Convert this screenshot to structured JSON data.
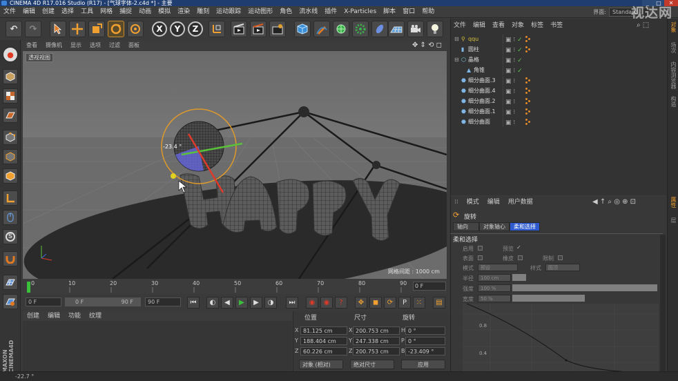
{
  "window": {
    "title": "CINEMA 4D R17.016 Studio (R17) - [气球字体-2.c4d *] - 主要",
    "controls": [
      "_",
      "□",
      "✕"
    ],
    "watermark": "视达网",
    "layout_label": "界面:",
    "layout_value": "Standard"
  },
  "menubar": {
    "items": [
      "文件",
      "编辑",
      "创建",
      "选择",
      "工具",
      "网格",
      "捕捉",
      "动画",
      "模拟",
      "渲染",
      "雕刻",
      "运动跟踪",
      "运动图形",
      "角色",
      "流水线",
      "插件",
      "X-Particles",
      "脚本",
      "窗口",
      "帮助"
    ]
  },
  "toolbar": {
    "undo_icon": "↶",
    "redo_icon": "↷",
    "axis_x": "X",
    "axis_y": "Y",
    "axis_z": "Z"
  },
  "viewport": {
    "menu": [
      "查看",
      "摄像机",
      "显示",
      "选项",
      "过滤",
      "面板"
    ],
    "camera_label": "透视视图",
    "grid_distance": "网格间距 : 1000 cm",
    "rotation_readout": "-23.4 °",
    "text_3d": "HAPPY",
    "nav_icons": "✥ ⇕ ⟲ ◻"
  },
  "timeline": {
    "ticks": [
      "0",
      "10",
      "20",
      "30",
      "40",
      "50",
      "60",
      "70",
      "80",
      "90"
    ],
    "current_frame": "0 F",
    "start_field": "0 F",
    "range_start": "0 F",
    "range_end": "90 F",
    "end_field": "90 F"
  },
  "materials": {
    "menu": [
      "创建",
      "编辑",
      "功能",
      "纹理"
    ]
  },
  "coordinates": {
    "headers": [
      "位置",
      "尺寸",
      "旋转"
    ],
    "rows": [
      {
        "axis": "X",
        "pos": "81.125 cm",
        "size_axis": "X",
        "size": "200.753 cm",
        "rot_axis": "H",
        "rot": "0 °"
      },
      {
        "axis": "Y",
        "pos": "188.404 cm",
        "size_axis": "Y",
        "size": "247.338 cm",
        "rot_axis": "P",
        "rot": "0 °"
      },
      {
        "axis": "Z",
        "pos": "60.226 cm",
        "size_axis": "Z",
        "size": "200.753 cm",
        "rot_axis": "B",
        "rot": "-23.409 °"
      }
    ],
    "mode_select": "对象 (相对)",
    "size_select": "绝对尺寸",
    "apply_button": "应用"
  },
  "object_manager": {
    "menu": [
      "文件",
      "编辑",
      "查看",
      "对象",
      "标签",
      "书签"
    ],
    "objects": [
      {
        "name": "qqu",
        "indent": 0,
        "color": "#d9c23c"
      },
      {
        "name": "圆柱",
        "indent": 0,
        "color": "#7fb6e6"
      },
      {
        "name": "晶格",
        "indent": 0,
        "color": "#7fd4e6"
      },
      {
        "name": "角锥",
        "indent": 1,
        "color": "#7fb6e6"
      },
      {
        "name": "细分曲面.3",
        "indent": 0,
        "color": "#7fb6e6"
      },
      {
        "name": "细分曲面.4",
        "indent": 0,
        "color": "#7fb6e6"
      },
      {
        "name": "细分曲面.2",
        "indent": 0,
        "color": "#7fb6e6"
      },
      {
        "name": "细分曲面.1",
        "indent": 0,
        "color": "#7fb6e6"
      },
      {
        "name": "细分曲面",
        "indent": 0,
        "color": "#7fb6e6"
      }
    ]
  },
  "attribute_manager": {
    "menu": [
      "模式",
      "编辑",
      "用户数据"
    ],
    "tool_name": "旋转",
    "tabs": [
      "轴向",
      "对象轴心",
      "柔和选择"
    ],
    "section_title": "柔和选择",
    "fields": {
      "enable": "启用",
      "preview": "预览",
      "surface": "表面",
      "rubber": "橡皮",
      "limit": "限制",
      "mode": "模式",
      "mode_value": "预设",
      "style": "样式",
      "style_value": "圆顶",
      "radius": "半径",
      "radius_value": "100 cm",
      "strength": "强度",
      "strength_value": "100 %",
      "width": "宽度",
      "width_value": "50 %"
    },
    "graph_labels": [
      "0.8",
      "0.4"
    ]
  },
  "right_tabs": [
    "对象",
    "场次",
    "内容浏览器",
    "构造",
    "属性",
    "层"
  ],
  "status_text": "-22.7 °"
}
